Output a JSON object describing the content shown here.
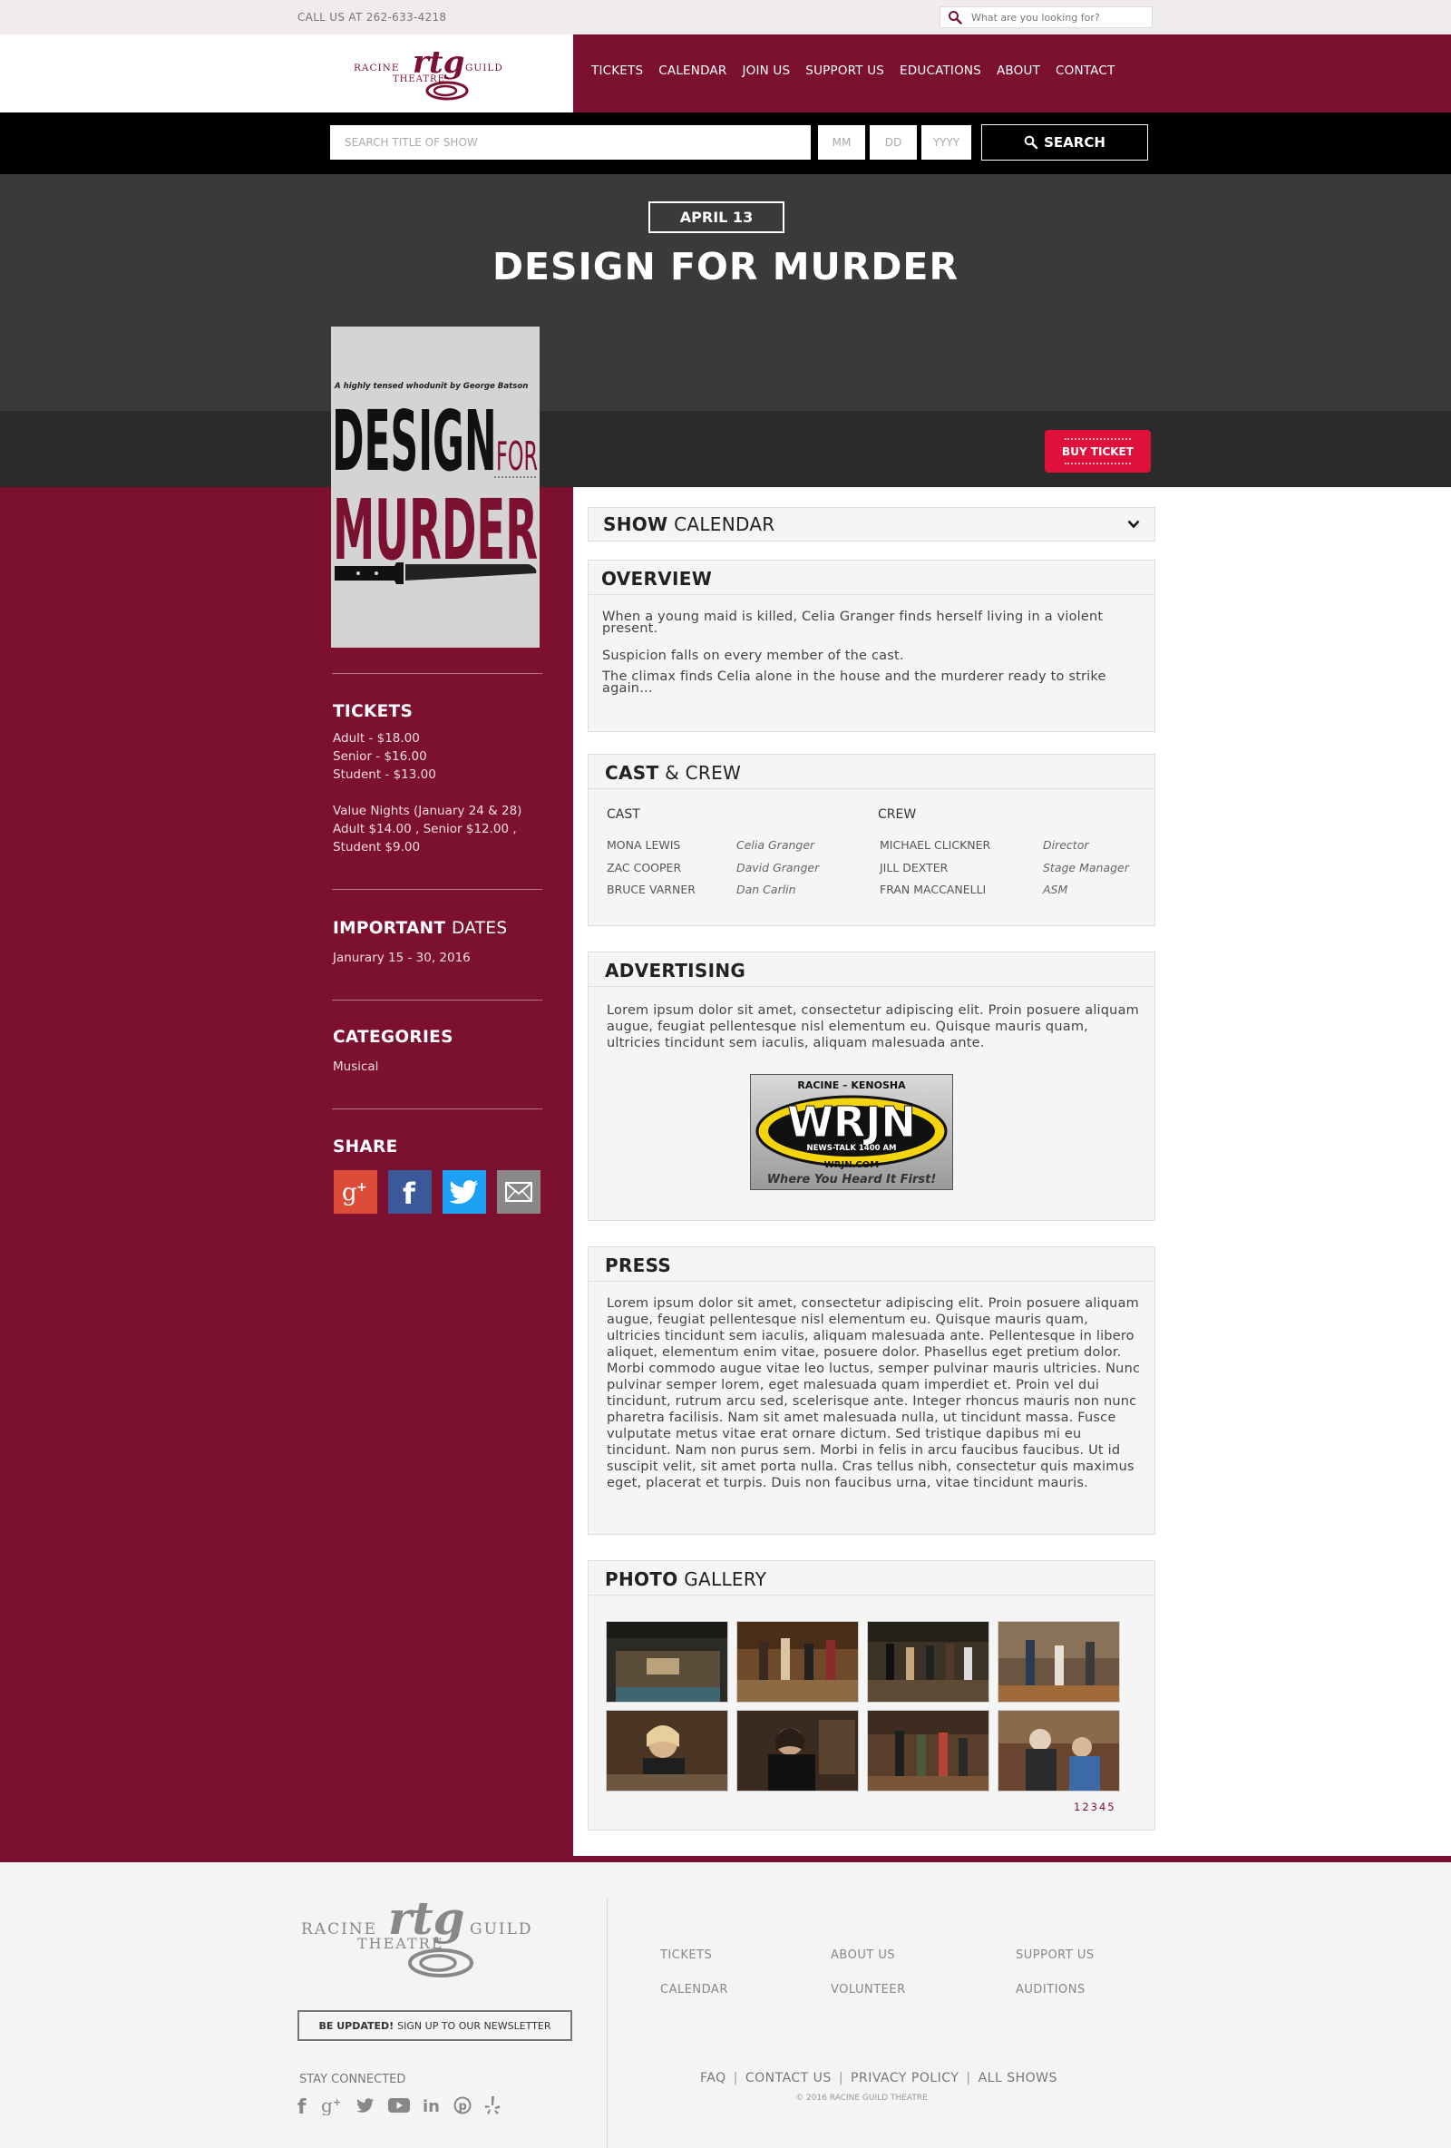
{
  "topbar": {
    "call_us": "CALL US AT 262-633-4218",
    "search_placeholder": "What are you looking for?"
  },
  "logo": {
    "left_word": "RACINE",
    "right_word": "GUILD",
    "bottom_word": "THEATRE",
    "mark": "rtg"
  },
  "nav": {
    "items": [
      "TICKETS",
      "CALENDAR",
      "JOIN US",
      "SUPPORT US",
      "EDUCATIONS",
      "ABOUT",
      "CONTACT"
    ]
  },
  "searchbar": {
    "title_placeholder": "SEARCH TITLE OF SHOW",
    "mm_placeholder": "MM",
    "dd_placeholder": "DD",
    "yyyy_placeholder": "YYYY",
    "button_label": "SEARCH"
  },
  "hero": {
    "date": "APRIL 13",
    "title": "DESIGN FOR MURDER",
    "buy_label": "BUY TICKET"
  },
  "poster": {
    "tagline": "A highly tensed whodunit by George Batson",
    "word1": "DESIGN",
    "word2": "FOR",
    "word3": "MURDER"
  },
  "sidebar": {
    "tickets_heading": "TICKETS",
    "tickets_lines": [
      "Adult - $18.00",
      "Senior - $16.00",
      "Student - $13.00"
    ],
    "value_lines": [
      "Value Nights (January 24 & 28)",
      "Adult $14.00 , Senior $12.00 ,",
      "Student $9.00"
    ],
    "dates_heading_bold": "IMPORTANT",
    "dates_heading_light": "DATES",
    "dates_text": "Janurary 15 - 30, 2016",
    "categories_heading": "CATEGORIES",
    "categories_text": "Musical",
    "share_heading": "SHARE",
    "share_icons": [
      "google-plus-icon",
      "facebook-icon",
      "twitter-icon",
      "email-icon"
    ],
    "colors": {
      "google": "#dd4b39",
      "facebook": "#3b5998",
      "twitter": "#1da1f2",
      "email": "#888888"
    }
  },
  "calendar": {
    "bold": "SHOW",
    "light": "CALENDAR"
  },
  "overview": {
    "heading": "OVERVIEW",
    "paragraphs": [
      "When a young maid is killed, Celia Granger finds herself living in a violent present.",
      "Suspicion falls on every member of the cast.",
      "The climax finds Celia alone in the house and the murderer ready to strike again..."
    ]
  },
  "cast_crew": {
    "bold": "CAST",
    "light": "& CREW",
    "cast_label": "CAST",
    "crew_label": "CREW",
    "cast": [
      {
        "name": "MONA LEWIS",
        "role": "Celia Granger"
      },
      {
        "name": "ZAC COOPER",
        "role": "David Granger"
      },
      {
        "name": "BRUCE VARNER",
        "role": "Dan Carlin"
      }
    ],
    "crew": [
      {
        "name": "MICHAEL CLICKNER",
        "role": "Director"
      },
      {
        "name": "JILL DEXTER",
        "role": "Stage Manager"
      },
      {
        "name": "FRAN MACCANELLI",
        "role": "ASM"
      }
    ]
  },
  "advertising": {
    "heading": "ADVERTISING",
    "text": "Lorem ipsum dolor sit amet, consectetur adipiscing elit. Proin posuere aliquam augue, feugiat pellentesque nisl elementum eu. Quisque mauris quam, ultricies tincidunt sem iaculis, aliquam malesuada ante.",
    "ad_top": "RACINE – KENOSHA",
    "ad_brand": "WRJN",
    "ad_sub": "NEWS-TALK 1400 AM",
    "ad_url": "WRJN.COM",
    "ad_slogan": "Where You Heard It First!"
  },
  "press": {
    "heading": "PRESS",
    "text": "Lorem ipsum dolor sit amet, consectetur adipiscing elit. Proin posuere aliquam augue, feugiat pellentesque nisl elementum eu. Quisque mauris quam, ultricies tincidunt sem iaculis, aliquam malesuada ante. Pellentesque in libero aliquet, elementum enim vitae, posuere dolor. Phasellus eget pretium dolor. Morbi commodo augue vitae leo luctus, semper pulvinar mauris ultricies. Nunc pulvinar semper lorem, eget malesuada quam imperdiet et. Proin vel dui tincidunt, rutrum arcu sed, scelerisque ante. Integer rhoncus mauris non nunc pharetra facilisis. Nam sit amet malesuada nulla, ut tincidunt massa. Fusce vulputate metus vitae erat ornare dictum. Sed tristique dapibus mi eu tincidunt. Nam non purus sem. Morbi in felis in arcu faucibus faucibus. Ut id suscipit velit, sit amet porta nulla. Cras tellus nibh, consectetur quis maximus eget, placerat et turpis. Duis non faucibus urna, vitae tincidunt mauris."
  },
  "gallery": {
    "bold": "PHOTO",
    "light": "GALLERY",
    "pager": "12345"
  },
  "footer": {
    "newsletter_bold": "BE UPDATED!",
    "newsletter_light": "SIGN UP TO OUR NEWSLETTER",
    "stay_connected": "STAY CONNECTED",
    "col1": [
      "TICKETS",
      "CALENDAR"
    ],
    "col2": [
      "ABOUT US",
      "VOLUNTEER"
    ],
    "col3": [
      "SUPPORT US",
      "AUDITIONS"
    ],
    "bottom_links": [
      "FAQ",
      "CONTACT US",
      "PRIVACY POLICY",
      "ALL SHOWS"
    ],
    "copyright": "© 2016 RACINE GUILD THEATRE",
    "social_icons": [
      "facebook-icon",
      "google-plus-icon",
      "twitter-icon",
      "youtube-icon",
      "linkedin-icon",
      "pinterest-icon",
      "yelp-icon"
    ]
  },
  "colors": {
    "brand": "#7b1030",
    "buy": "#e0103c",
    "hero": "#3a3a3a",
    "black": "#000000"
  }
}
